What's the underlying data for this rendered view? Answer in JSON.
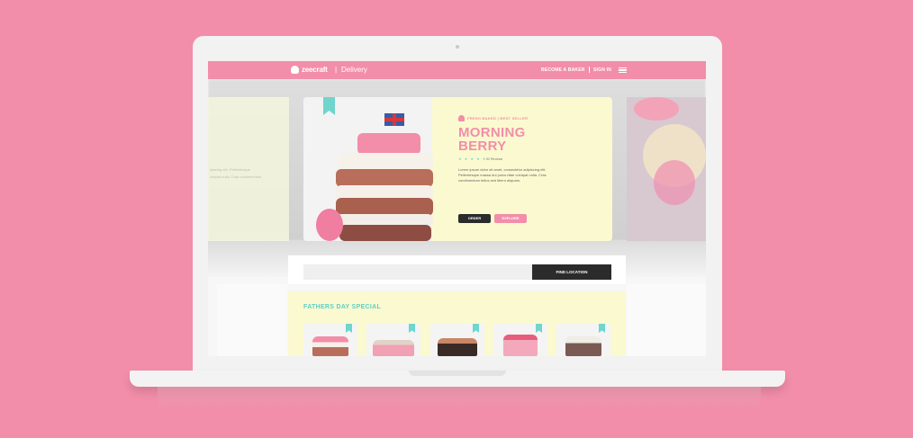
{
  "nav": {
    "brand": "zeecraft",
    "separator": "|",
    "section": "Delivery",
    "become_baker": "BECOME A BAKER",
    "sign_in": "SIGN IN"
  },
  "side_left": {
    "line1": "ipiscing elit. Pellentesque",
    "line2": "olutpat nulla. Cras condimentum"
  },
  "hero": {
    "category": "FRESH BAKED  |  BEST SELLER",
    "title": "MORNING BERRY",
    "stars": "★ ★ ★ ★ ★",
    "rating": 5,
    "reviews": "52 Reviews",
    "description": "Lorem ipsum dolor sit amet, consectetur adipiscing elit. Pellentesque massa dui porta vitae volutpat nulla. Cras condimentum tellus sed libero aliquam.",
    "order_label": "ORDER",
    "explore_label": "EXPLORE"
  },
  "location": {
    "placeholder": "",
    "button_label": "FIND LOCATION"
  },
  "special": {
    "title": "FATHERS DAY SPECIAL",
    "items": [
      {
        "name": "berry-cake"
      },
      {
        "name": "cream-cake"
      },
      {
        "name": "chocolate-cake"
      },
      {
        "name": "pink-cake"
      },
      {
        "name": "drip-cake"
      }
    ]
  },
  "colors": {
    "background": "#f28ea9",
    "accent": "#f28ea9",
    "teal": "#6fd5cd",
    "card": "#fbf9cf",
    "dark_button": "#2b2b2b"
  }
}
